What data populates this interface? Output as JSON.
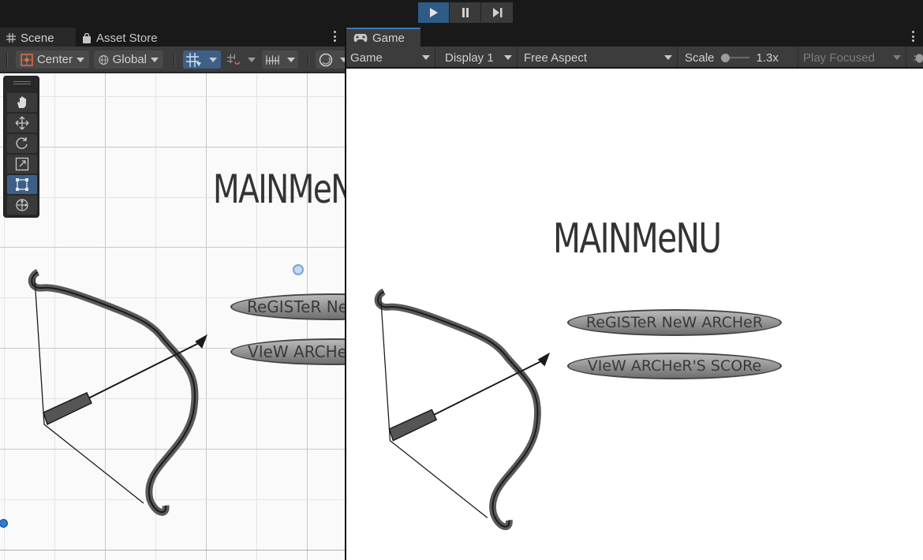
{
  "playbar": {
    "play_icon": "play-icon",
    "pause_icon": "pause-icon",
    "step_icon": "step-icon",
    "colors": {
      "active": "#2f5b87"
    }
  },
  "scene_panel": {
    "tabs": [
      {
        "label": "Scene",
        "icon": "grid-icon"
      },
      {
        "label": "Asset Store",
        "icon": "bag-icon"
      }
    ],
    "toolbar": {
      "pivot_label": "Center",
      "handle_label": "Global"
    },
    "title": "MAINMeNU",
    "buttons": [
      {
        "label": "ReGISTeR Ne"
      },
      {
        "label": "VIeW ARCHe"
      }
    ]
  },
  "game_panel": {
    "tab_label": "Game",
    "tab_icon": "gamepad-icon",
    "toolbar": {
      "view_select": "Game",
      "display_select": "Display 1",
      "aspect_select": "Free Aspect",
      "scale_label": "Scale",
      "scale_value": "1.3x",
      "play_mode": "Play Focused"
    },
    "title": "MAINMeNU",
    "buttons": [
      {
        "label": "ReGISTeR NeW ARCHeR"
      },
      {
        "label": "VIeW ARCHeR'S SCORe"
      }
    ]
  }
}
